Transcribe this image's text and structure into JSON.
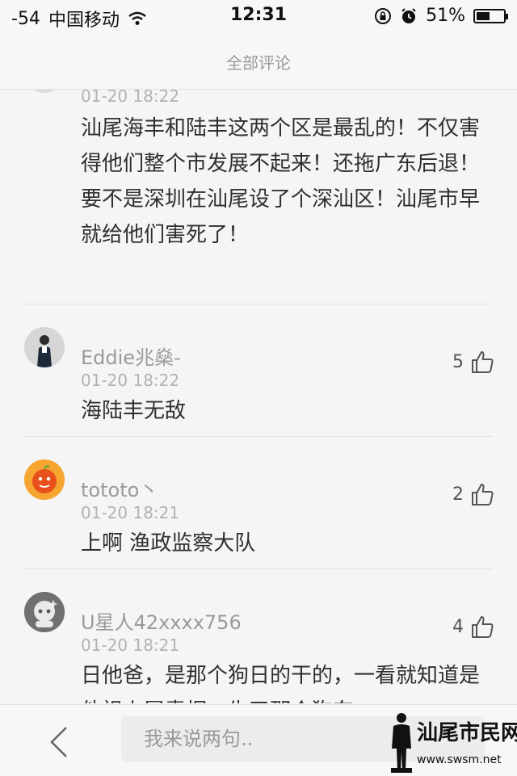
{
  "status_bar": {
    "signal": "-54",
    "carrier": "中国移动",
    "time": "12:31",
    "battery": "51%",
    "battery_level": 0.51
  },
  "header": {
    "title": "全部评论"
  },
  "comments": [
    {
      "username": "",
      "time": "01-20 18:22",
      "content": "汕尾海丰和陆丰这两个区是最乱的！不仅害得他们整个市发展不起来！还拖广东后退！要不是深圳在汕尾设了个深汕区！汕尾市早就给他们害死了！",
      "likes": ""
    },
    {
      "username": "Eddie兆燊-",
      "time": "01-20 18:22",
      "content": "海陆丰无敌",
      "likes": "5"
    },
    {
      "username": "tototo丶",
      "time": "01-20 18:21",
      "content": "上啊 渔政监察大队",
      "likes": "2"
    },
    {
      "username": "U星人42xxxx756",
      "time": "01-20 18:21",
      "content": "日他爸，是那个狗日的干的，一看就知道是他祖上冒青烟，生了那个狗东",
      "likes": "4"
    }
  ],
  "footer": {
    "input_placeholder": "我来说两句..",
    "watermark_text": "汕尾市民网",
    "watermark_url": "www.swsm.net"
  },
  "colors": {
    "background": "#f5f5f5",
    "text_primary": "#2f2f2f",
    "text_secondary": "#9a9a9a",
    "divider": "#e3e3e3"
  },
  "icons": [
    "wifi-icon",
    "orientation-lock-icon",
    "alarm-icon",
    "battery-icon",
    "thumbs-up-icon",
    "back-chevron-icon"
  ]
}
